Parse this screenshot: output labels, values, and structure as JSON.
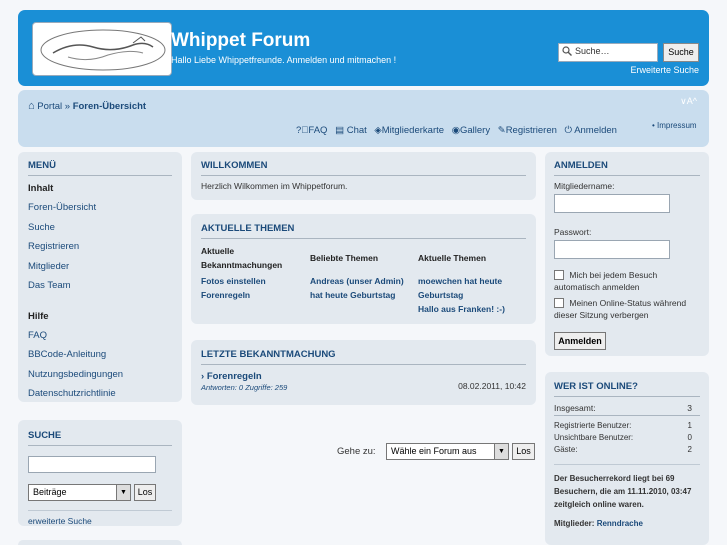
{
  "header": {
    "title": "Whippet Forum",
    "description": "Hallo Liebe Whippetfreunde. Anmelden und mitmachen !",
    "search_placeholder": "Suche…",
    "search_button": "Suche",
    "advanced_search": "Erweiterte Suche"
  },
  "breadcrumb": {
    "portal": "Portal",
    "sep": "»",
    "current": "Foren-Übersicht"
  },
  "font_controls": "∨A^",
  "navlinks": {
    "faq": "FAQ",
    "chat": "Chat",
    "memberMap": "Mitgliederkarte",
    "gallery": "Gallery",
    "register": "Registrieren",
    "login": "Anmelden",
    "impressum": "Impressum"
  },
  "menu": {
    "title": "MENÜ",
    "section_content": "Inhalt",
    "content_items": [
      "Foren-Übersicht",
      "Suche",
      "Registrieren",
      "Mitglieder",
      "Das Team"
    ],
    "section_help": "Hilfe",
    "help_items": [
      "FAQ",
      "BBCode-Anleitung",
      "Nutzungsbedingungen",
      "Datenschutzrichtlinie"
    ]
  },
  "search_panel": {
    "title": "SUCHE",
    "select_value": "Beiträge",
    "button": "Los",
    "advanced": "erweiterte Suche"
  },
  "welcome": {
    "title": "WILLKOMMEN",
    "text": "Herzlich Wilkommen im Whippetforum."
  },
  "topics": {
    "title": "AKTUELLE THEMEN",
    "columns": [
      {
        "heading": "Aktuelle Bekanntmachungen",
        "items": [
          "Fotos einstellen",
          "Forenregeln"
        ]
      },
      {
        "heading": "Beliebte Themen",
        "items": [
          "Andreas (unser Admin) hat heute Geburtstag"
        ]
      },
      {
        "heading": "Aktuelle Themen",
        "items": [
          "moewchen hat heute Geburtstag",
          "Hallo aus Franken! :-)"
        ]
      }
    ]
  },
  "announcement": {
    "title": "LETZTE BEKANNTMACHUNG",
    "topic": "Forenregeln",
    "meta": "Antworten: 0 Zugriffe: 259",
    "date": "08.02.2011, 10:42"
  },
  "jumpbox": {
    "label": "Gehe zu:",
    "select_value": "Wähle ein Forum aus",
    "button": "Los"
  },
  "login": {
    "title": "ANMELDEN",
    "username_label": "Mitgliedername:",
    "password_label": "Passwort:",
    "autologin": "Mich bei jedem Besuch automatisch anmelden",
    "hide_status": "Meinen Online-Status während dieser Sitzung verbergen",
    "button": "Anmelden"
  },
  "online": {
    "title": "WER IST ONLINE?",
    "total_label": "Insgesamt:",
    "total_value": "3",
    "registered_label": "Registrierte Benutzer:",
    "registered_value": "1",
    "hidden_label": "Unsichtbare Benutzer:",
    "hidden_value": "0",
    "guests_label": "Gäste:",
    "guests_value": "2",
    "record": "Der Besucherrekord liegt bei 69 Besuchern, die am 11.11.2010, 03:47 zeitgleich online waren.",
    "members_label": "Mitglieder:",
    "members_value": "Renndrache"
  }
}
